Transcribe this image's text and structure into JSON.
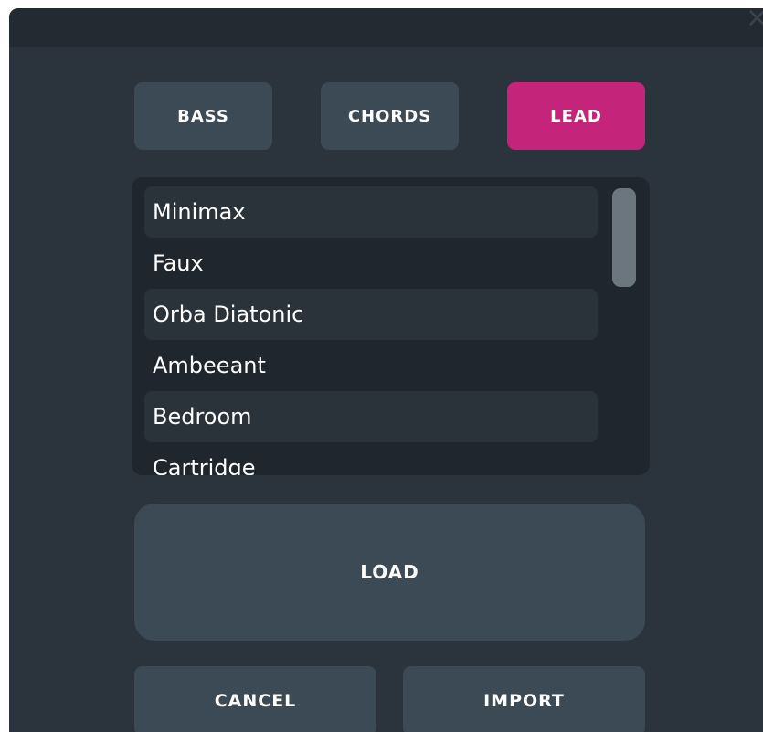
{
  "dialog": {
    "close_glyph": "×"
  },
  "tabs": [
    {
      "label": "BASS",
      "active": false
    },
    {
      "label": "CHORDS",
      "active": false
    },
    {
      "label": "LEAD",
      "active": true
    }
  ],
  "preset_list": {
    "items": [
      "Minimax",
      "Faux",
      "Orba Diatonic",
      "Ambeeant",
      "Bedroom",
      "Cartridge"
    ]
  },
  "actions": {
    "load_label": "LOAD",
    "cancel_label": "CANCEL",
    "import_label": "IMPORT"
  },
  "colors": {
    "dialog_bg": "#2b343d",
    "titlebar_bg": "#232a32",
    "button_bg": "#3c4a55",
    "active_tab": "#c4247a",
    "list_bg": "#1f262d",
    "scrollbar": "#6c767f"
  }
}
